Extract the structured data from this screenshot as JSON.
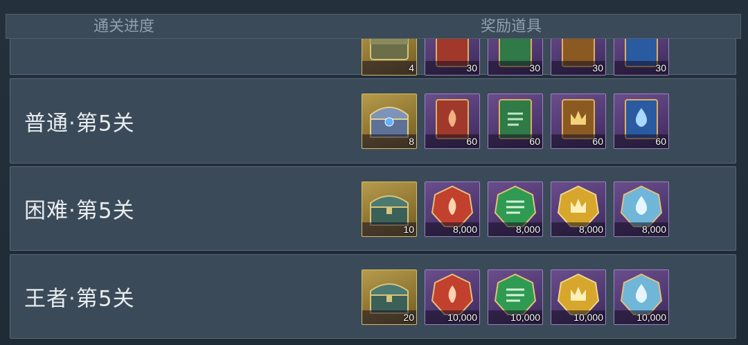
{
  "header": {
    "stage_col": "通关进度",
    "reward_col": "奖励道具"
  },
  "rows": [
    {
      "label": "",
      "rewards": [
        {
          "icon": "chest-icon",
          "count": "4"
        },
        {
          "icon": "red-fire-book-icon",
          "count": "30"
        },
        {
          "icon": "green-wind-book-icon",
          "count": "30"
        },
        {
          "icon": "brown-crown-book-icon",
          "count": "30"
        },
        {
          "icon": "blue-water-book-icon",
          "count": "30"
        }
      ]
    },
    {
      "label": "普通·第5关",
      "rewards": [
        {
          "icon": "silver-blue-chest-icon",
          "count": "8"
        },
        {
          "icon": "red-fire-book-icon",
          "count": "60"
        },
        {
          "icon": "green-wind-book-icon",
          "count": "60"
        },
        {
          "icon": "brown-crown-book-icon",
          "count": "60"
        },
        {
          "icon": "blue-water-book-icon",
          "count": "60"
        }
      ]
    },
    {
      "label": "困难·第5关",
      "rewards": [
        {
          "icon": "jade-chest-icon",
          "count": "10"
        },
        {
          "icon": "red-fire-gem-icon",
          "count": "8,000"
        },
        {
          "icon": "green-wind-gem-icon",
          "count": "8,000"
        },
        {
          "icon": "gold-crown-gem-icon",
          "count": "8,000"
        },
        {
          "icon": "blue-water-gem-icon",
          "count": "8,000"
        }
      ]
    },
    {
      "label": "王者·第5关",
      "rewards": [
        {
          "icon": "jade-chest-icon",
          "count": "20"
        },
        {
          "icon": "red-fire-gem-icon",
          "count": "10,000"
        },
        {
          "icon": "green-wind-gem-icon",
          "count": "10,000"
        },
        {
          "icon": "gold-crown-gem-icon",
          "count": "10,000"
        },
        {
          "icon": "blue-water-gem-icon",
          "count": "10,000"
        }
      ]
    }
  ]
}
